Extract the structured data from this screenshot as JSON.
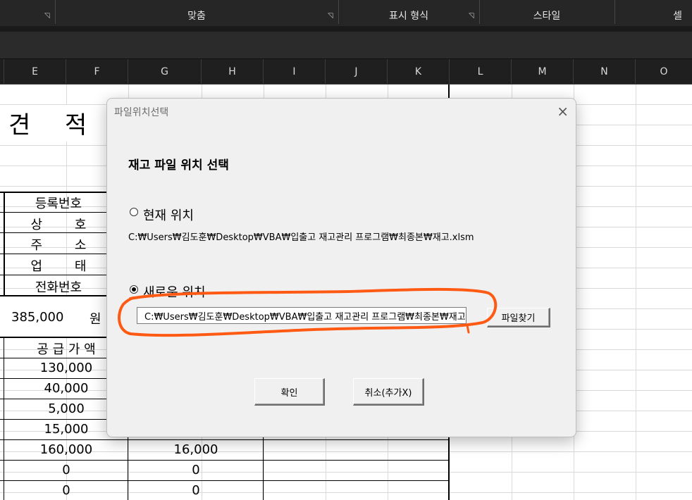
{
  "ribbon": {
    "groups": [
      "맞춤",
      "표시 형식",
      "스타일",
      "셀"
    ]
  },
  "columns": [
    "E",
    "F",
    "G",
    "H",
    "I",
    "J",
    "K",
    "L",
    "M",
    "N",
    "O"
  ],
  "sheet": {
    "title_char1": "견",
    "title_char2": "적",
    "labels": [
      "등록번호",
      "상        호",
      "주        소",
      "업        태",
      "전화번호"
    ],
    "total_amount": "385,000",
    "total_unit": "원",
    "supply_header": "공 급 가 액",
    "supply_values": [
      "130,000",
      "40,000",
      "5,000",
      "15,000",
      "160,000",
      "0",
      "0"
    ],
    "tax_values": [
      "16,000",
      "0",
      "0"
    ]
  },
  "dialog": {
    "title": "파일위치선택",
    "close": "×",
    "heading": "재고 파일 위치 선택",
    "option_current": "현재 위치",
    "current_path": "C:₩Users₩김도훈₩Desktop₩VBA₩입출고 재고관리 프로그램₩최종본₩재고.xlsm",
    "option_new": "새로운 위치",
    "new_path": "C:₩Users₩김도훈₩Desktop₩VBA₩입출고 재고관리 프로그램₩최종본₩재고.xlsm",
    "browse_button": "파일찾기",
    "ok_button": "확인",
    "cancel_button": "취소(추가X)",
    "selected_option": "new"
  },
  "colors": {
    "ribbon_bg": "#262626",
    "dialog_bg": "#f0f0f0",
    "highlight_stroke": "#ff5a14"
  }
}
